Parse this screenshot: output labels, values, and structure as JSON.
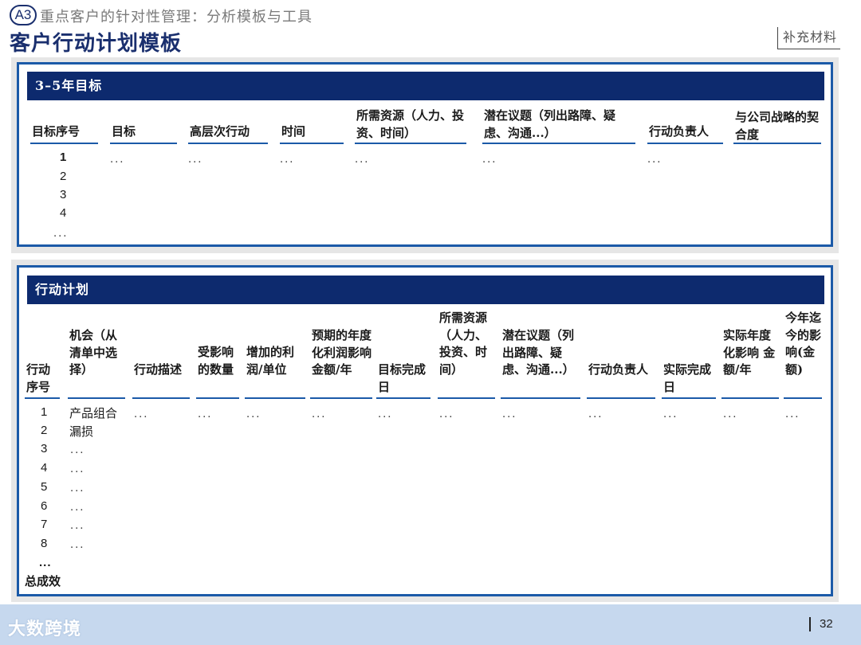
{
  "header": {
    "badge": "A3",
    "subtitle": "重点客户的针对性管理：分析模板与工具",
    "title": "客户行动计划模板",
    "tag": "补充材料"
  },
  "goals": {
    "bar_title": "3–5年目标",
    "columns": [
      "目标序号",
      "目标",
      "高层次行动",
      "时间",
      "所需资源（人力、投资、时间）",
      "潜在议题（列出路障、疑虑、沟通...）",
      "行动负责人",
      "与公司战略的契合度"
    ],
    "rows": [
      "1",
      "2",
      "3",
      "4",
      "..."
    ],
    "first_row_fill": "..."
  },
  "plan": {
    "bar_title": "行动计划",
    "columns": [
      "行动序号",
      "机会（从清单中选择）",
      "行动描述",
      "受影响的数量",
      "增加的利润/单位",
      "预期的年度化利润影响 金额/年",
      "目标完成日",
      "所需资源（人力、投资、时间）",
      "潜在议题（列出路障、疑虑、沟通...）",
      "行动负责人",
      "实际完成日",
      "实际年度化影响 金额/年",
      "今年迄今的影响(金额)"
    ],
    "rows": [
      {
        "no": "1",
        "opp": "产品组合"
      },
      {
        "no": "2",
        "opp": "漏损"
      },
      {
        "no": "3",
        "opp": "..."
      },
      {
        "no": "4",
        "opp": "..."
      },
      {
        "no": "5",
        "opp": "..."
      },
      {
        "no": "6",
        "opp": "..."
      },
      {
        "no": "7",
        "opp": "..."
      },
      {
        "no": "8",
        "opp": "..."
      },
      {
        "no": "...",
        "opp": ""
      }
    ],
    "total_label": "总成效",
    "first_row_fill": "..."
  },
  "footer": {
    "logo": "大数跨境",
    "page": "32"
  },
  "colors": {
    "navy": "#0d2a6e",
    "blue_border": "#1b5aa8",
    "footer_bg": "#c6d8ee"
  }
}
